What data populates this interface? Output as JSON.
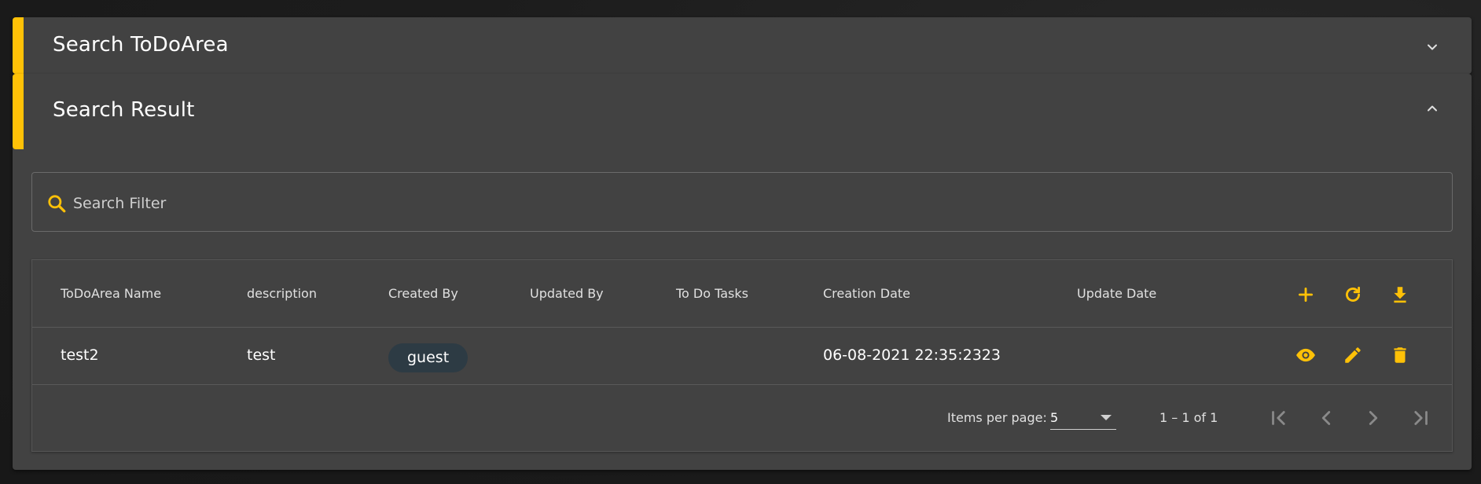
{
  "colors": {
    "accent": "#ffc107",
    "panel": "#424242",
    "chip": "#2d3b44",
    "background": "#1c1c1c"
  },
  "search_panel": {
    "title": "Search ToDoArea",
    "toggle_icon": "chevron-down-icon"
  },
  "result_panel": {
    "title": "Search Result",
    "toggle_icon": "chevron-up-icon",
    "filter": {
      "icon": "search-icon",
      "placeholder": "Search Filter",
      "value": ""
    },
    "table": {
      "columns": [
        "ToDoArea Name",
        "description",
        "Created By",
        "Updated By",
        "To Do Tasks",
        "Creation Date",
        "Update Date"
      ],
      "header_actions": [
        "add-icon",
        "refresh-icon",
        "download-icon"
      ],
      "rows": [
        {
          "name": "test2",
          "description": "test",
          "created_by": "guest",
          "updated_by": "",
          "todo_tasks": "",
          "creation_date": "06-08-2021 22:35:2323",
          "update_date": "",
          "actions": [
            "view-icon",
            "edit-icon",
            "delete-icon"
          ]
        }
      ]
    },
    "paginator": {
      "items_per_page_label": "Items per page:",
      "items_per_page": "5",
      "range_label": "1 – 1 of 1",
      "buttons": [
        "first-page-icon",
        "previous-page-icon",
        "next-page-icon",
        "last-page-icon"
      ]
    }
  }
}
